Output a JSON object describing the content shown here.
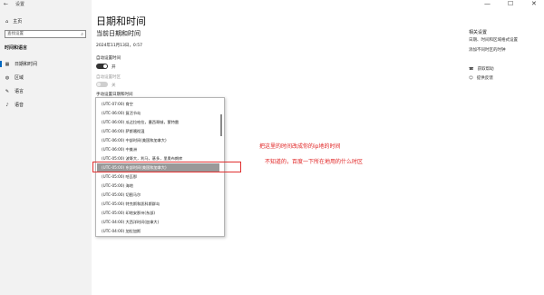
{
  "window": {
    "title": "设置",
    "back": "←",
    "controls": [
      "—",
      "☐",
      "✕"
    ]
  },
  "sidebar": {
    "home": "主页",
    "search_placeholder": "查找设置",
    "section": "时间和语言",
    "items": [
      {
        "label": "日期和时间",
        "icon": "calendar-icon"
      },
      {
        "label": "区域",
        "icon": "globe-icon"
      },
      {
        "label": "语言",
        "icon": "language-icon"
      },
      {
        "label": "语音",
        "icon": "microphone-icon"
      }
    ]
  },
  "main": {
    "title": "日期和时间",
    "subtitle": "当前日期和时间",
    "current_datetime": "2024年11月13日，0:57",
    "auto_time_label": "自动设置时间",
    "auto_time_state": "开",
    "auto_tz_label": "自动设置时区",
    "auto_tz_state": "关",
    "manual_label": "手动设置日期和时间"
  },
  "timezone_list": {
    "items": [
      "(UTC-07:00) 育空",
      "(UTC-06:00) 复活节岛",
      "(UTC-06:00) 瓜达拉哈拉，墨西哥城，蒙特雷",
      "(UTC-06:00) 萨斯喀彻温",
      "(UTC-06:00) 中部时间(美国和加拿大)",
      "(UTC-06:00) 中美洲",
      "(UTC-05:00) 波哥大，利马，基多，里奥布朗库",
      "(UTC-05:00) 东部时间(美国和加拿大)",
      "(UTC-05:00) 哈瓦那",
      "(UTC-05:00) 海地",
      "(UTC-05:00) 切图马尔",
      "(UTC-05:00) 特克斯和凯科斯群岛",
      "(UTC-05:00) 印地安那州(东部)",
      "(UTC-04:00) 大西洋时间(加拿大)",
      "(UTC-04:00) 加拉加斯"
    ],
    "selected_index": 7
  },
  "annotation": {
    "line1": "把这里的时间改成你的ip地的时间",
    "line2": "不知道的，百度一下所在地用的什么时区",
    "color": "#e02020"
  },
  "related": {
    "title": "相关设置",
    "links": [
      "日期、时间和区域格式设置",
      "添加不同时区的时钟"
    ],
    "help": [
      {
        "label": "获取帮助",
        "icon": "help-icon"
      },
      {
        "label": "提供反馈",
        "icon": "feedback-icon"
      }
    ]
  }
}
